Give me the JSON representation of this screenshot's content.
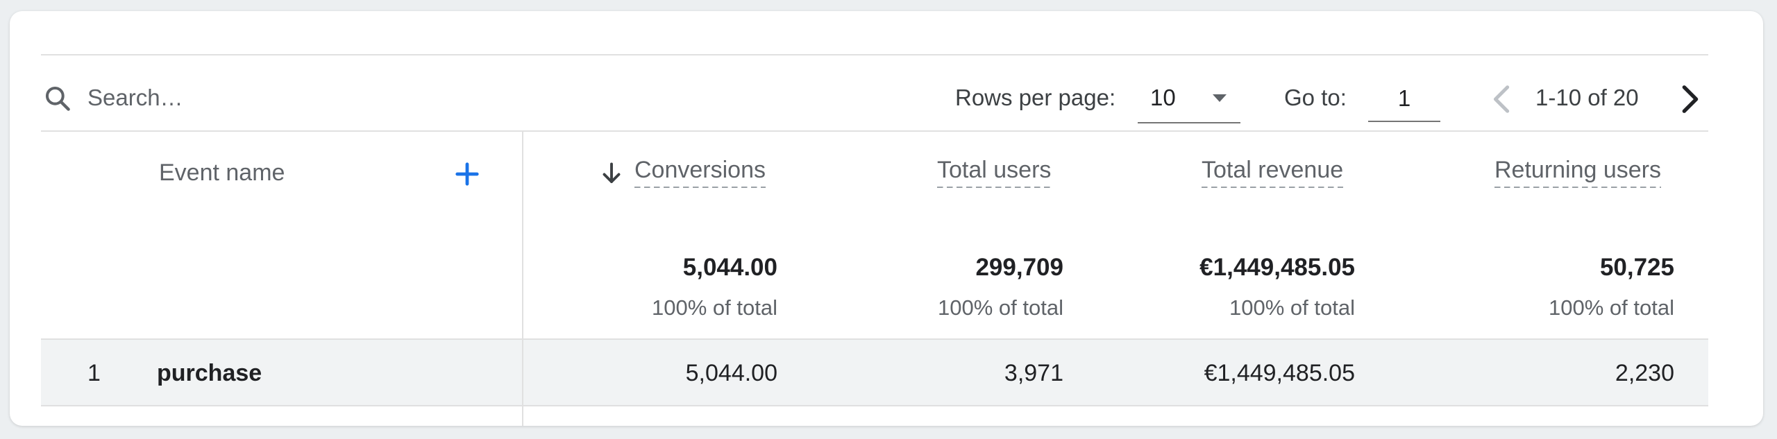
{
  "toolbar": {
    "search_placeholder": "Search…",
    "rows_per_page_label": "Rows per page:",
    "rows_per_page_value": "10",
    "go_to_label": "Go to:",
    "go_to_value": "1",
    "page_range": "1-10 of 20"
  },
  "table": {
    "dimension_header": "Event name",
    "columns": [
      {
        "label": "Conversions",
        "total": "5,044.00",
        "pct": "100% of total",
        "sorted": "descending"
      },
      {
        "label": "Total users",
        "total": "299,709",
        "pct": "100% of total"
      },
      {
        "label": "Total revenue",
        "total": "€1,449,485.05",
        "pct": "100% of total"
      },
      {
        "label": "Returning users",
        "total": "50,725",
        "pct": "100% of total"
      }
    ],
    "rows": [
      {
        "index": "1",
        "event": "purchase",
        "values": [
          "5,044.00",
          "3,971",
          "€1,449,485.05",
          "2,230"
        ]
      }
    ]
  },
  "icons": {
    "search": "search-icon",
    "dropdown": "caret-down-icon",
    "prev": "chevron-left-icon",
    "next": "chevron-right-icon",
    "add": "plus-icon",
    "sort": "arrow-down-icon"
  },
  "colors": {
    "accent": "#1a73e8",
    "row_highlight": "#f1f3f4",
    "text_primary": "#202124",
    "text_secondary": "#5f6368"
  }
}
